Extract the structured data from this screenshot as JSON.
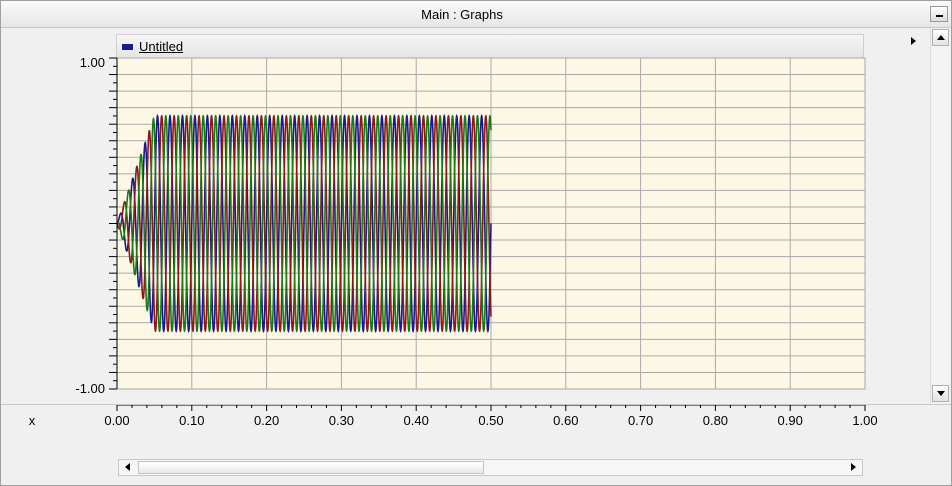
{
  "window": {
    "title": "Main : Graphs",
    "minimize_label": "–"
  },
  "legend": {
    "label": "Untitled",
    "swatch_color": "#1a1a8c"
  },
  "colors": {
    "plot_background": "#fdf8e6",
    "grid": "#a8a8a8",
    "series": [
      "#1a1a8c",
      "#8c1a1a",
      "#1a7a1a"
    ]
  },
  "chart_data": {
    "type": "line",
    "title": "",
    "xlabel": "x",
    "ylabel": "",
    "xlim": [
      0,
      1
    ],
    "ylim": [
      -1,
      1
    ],
    "x_ticks": [
      "0.00",
      "0.10",
      "0.20",
      "0.30",
      "0.40",
      "0.50",
      "0.60",
      "0.70",
      "0.80",
      "0.90",
      "1.00"
    ],
    "y_ticks": [
      "1.00",
      "-1.00"
    ],
    "grid": true,
    "signal": {
      "description": "three-phase sinusoidal waveform",
      "phases": 3,
      "phase_shift_deg": 120,
      "amplitude": 0.65,
      "frequency_hz": 60,
      "start_x": 0.0,
      "ramp_end_x": 0.05,
      "end_x": 0.5
    },
    "series": [
      {
        "color": "#1a1a8c",
        "phase_deg": 0
      },
      {
        "color": "#8c1a1a",
        "phase_deg": -120
      },
      {
        "color": "#1a7a1a",
        "phase_deg": 120
      }
    ]
  }
}
